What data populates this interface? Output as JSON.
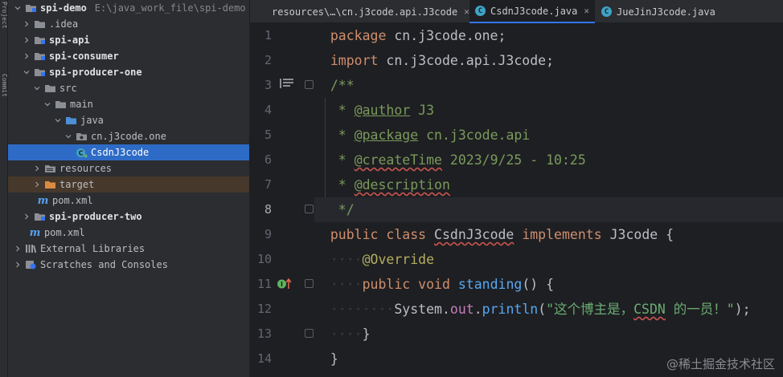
{
  "toolstrip": {
    "label1": "Project",
    "label2": "Commit"
  },
  "tree": {
    "rows": [
      {
        "label": "spi-demo",
        "path": "E:\\java_work_file\\spi-demo"
      },
      {
        "label": ".idea"
      },
      {
        "label": "spi-api"
      },
      {
        "label": "spi-consumer"
      },
      {
        "label": "spi-producer-one"
      },
      {
        "label": "src"
      },
      {
        "label": "main"
      },
      {
        "label": "java"
      },
      {
        "label": "cn.j3code.one"
      },
      {
        "label": "CsdnJ3code"
      },
      {
        "label": "resources"
      },
      {
        "label": "target"
      },
      {
        "label": "pom.xml"
      },
      {
        "label": "spi-producer-two"
      },
      {
        "label": "pom.xml"
      },
      {
        "label": "External Libraries"
      },
      {
        "label": "Scratches and Consoles"
      }
    ]
  },
  "tabs": [
    {
      "label": "resources\\…\\cn.j3code.api.J3code",
      "close": "✕"
    },
    {
      "label": "CsdnJ3code.java",
      "close": "✕",
      "active": true
    },
    {
      "label": "JueJinJ3code.java",
      "close": "✕"
    }
  ],
  "gutter": {
    "line_numbers": [
      "1",
      "2",
      "3",
      "4",
      "5",
      "6",
      "7",
      "8",
      "9",
      "10",
      "11",
      "12",
      "13",
      "14"
    ],
    "current_line": 8
  },
  "code": {
    "l1_kw": "package",
    "l1_rest": " cn.j3code.one;",
    "l2_kw": "import",
    "l2_rest": " cn.j3code.api.J3code;",
    "l3": "/**",
    "l4_star": " * ",
    "l4_tag": "@author",
    "l4_val": " J3",
    "l5_star": " * ",
    "l5_tag": "@package",
    "l5_val": " cn.j3code.api",
    "l6_star": " * ",
    "l6_tag": "@createTime",
    "l6_val": " 2023/9/25 - 10:25",
    "l7_star": " * ",
    "l7_tag": "@description",
    "l8": " */",
    "l9_kw1": "public",
    "l9_kw2": "class",
    "l9_name": "CsdnJ3code",
    "l9_kw3": "implements",
    "l9_iface": "J3code",
    "l9_brace": " {",
    "l10_ann": "@Override",
    "l11_kw1": "public",
    "l11_kw2": "void",
    "l11_fn": "standing",
    "l11_rest": "() {",
    "l12_cls": "System",
    "l12_dot1": ".",
    "l12_fld": "out",
    "l12_dot2": ".",
    "l12_fn": "println",
    "l12_open": "(",
    "l12_str1": "\"这个博主是，",
    "l12_str2": "CSDN",
    "l12_str3": " 的一员！\"",
    "l12_close": ");",
    "l13": "}",
    "l14": "}"
  },
  "watermark": "@稀土掘金技术社区",
  "colors": {
    "selection": "#2e6bc6",
    "background": "#1e1f22",
    "keyword": "#cf8e6d",
    "string": "#6aab73"
  }
}
